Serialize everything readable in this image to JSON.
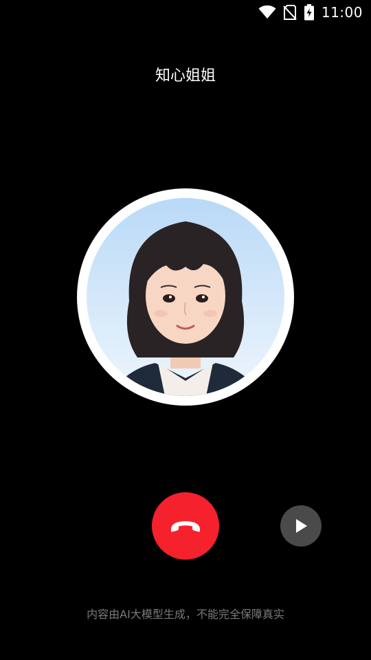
{
  "status_bar": {
    "time": "11:00",
    "icons": [
      "wifi-icon",
      "no-sim-icon",
      "battery-charging-icon"
    ]
  },
  "call": {
    "caller_name": "知心姐姐",
    "avatar": "avatar"
  },
  "controls": {
    "hangup_icon": "phone-hangup-icon",
    "play_icon": "play-icon"
  },
  "footer": {
    "disclaimer": "内容由AI大模型生成，不能完全保障真实"
  },
  "colors": {
    "background": "#000000",
    "hangup": "#f5222d",
    "play_button": "#4a4a4a",
    "disclaimer_text": "#7a7a7a"
  }
}
